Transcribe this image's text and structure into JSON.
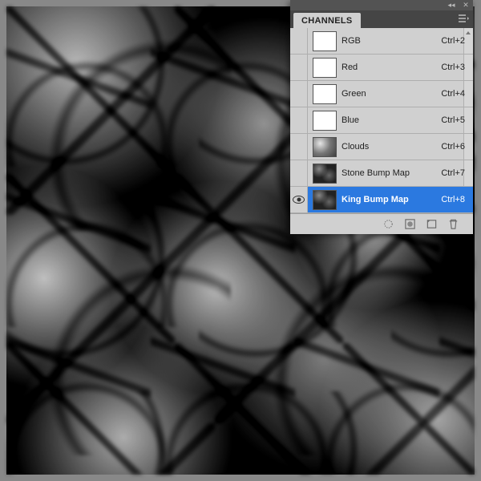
{
  "panel": {
    "tab_label": "CHANNELS",
    "channels": [
      {
        "name": "RGB",
        "shortcut": "Ctrl+2",
        "thumb": "white",
        "visible": false
      },
      {
        "name": "Red",
        "shortcut": "Ctrl+3",
        "thumb": "white",
        "visible": false
      },
      {
        "name": "Green",
        "shortcut": "Ctrl+4",
        "thumb": "white",
        "visible": false
      },
      {
        "name": "Blue",
        "shortcut": "Ctrl+5",
        "thumb": "white",
        "visible": false
      },
      {
        "name": "Clouds",
        "shortcut": "Ctrl+6",
        "thumb": "clouds",
        "visible": false
      },
      {
        "name": "Stone Bump Map",
        "shortcut": "Ctrl+7",
        "thumb": "stone",
        "visible": false
      },
      {
        "name": "King Bump Map",
        "shortcut": "Ctrl+8",
        "thumb": "king",
        "visible": true,
        "selected": true
      }
    ],
    "footer_icons": [
      "load-selection-icon",
      "save-selection-icon",
      "new-channel-icon",
      "delete-channel-icon"
    ]
  }
}
